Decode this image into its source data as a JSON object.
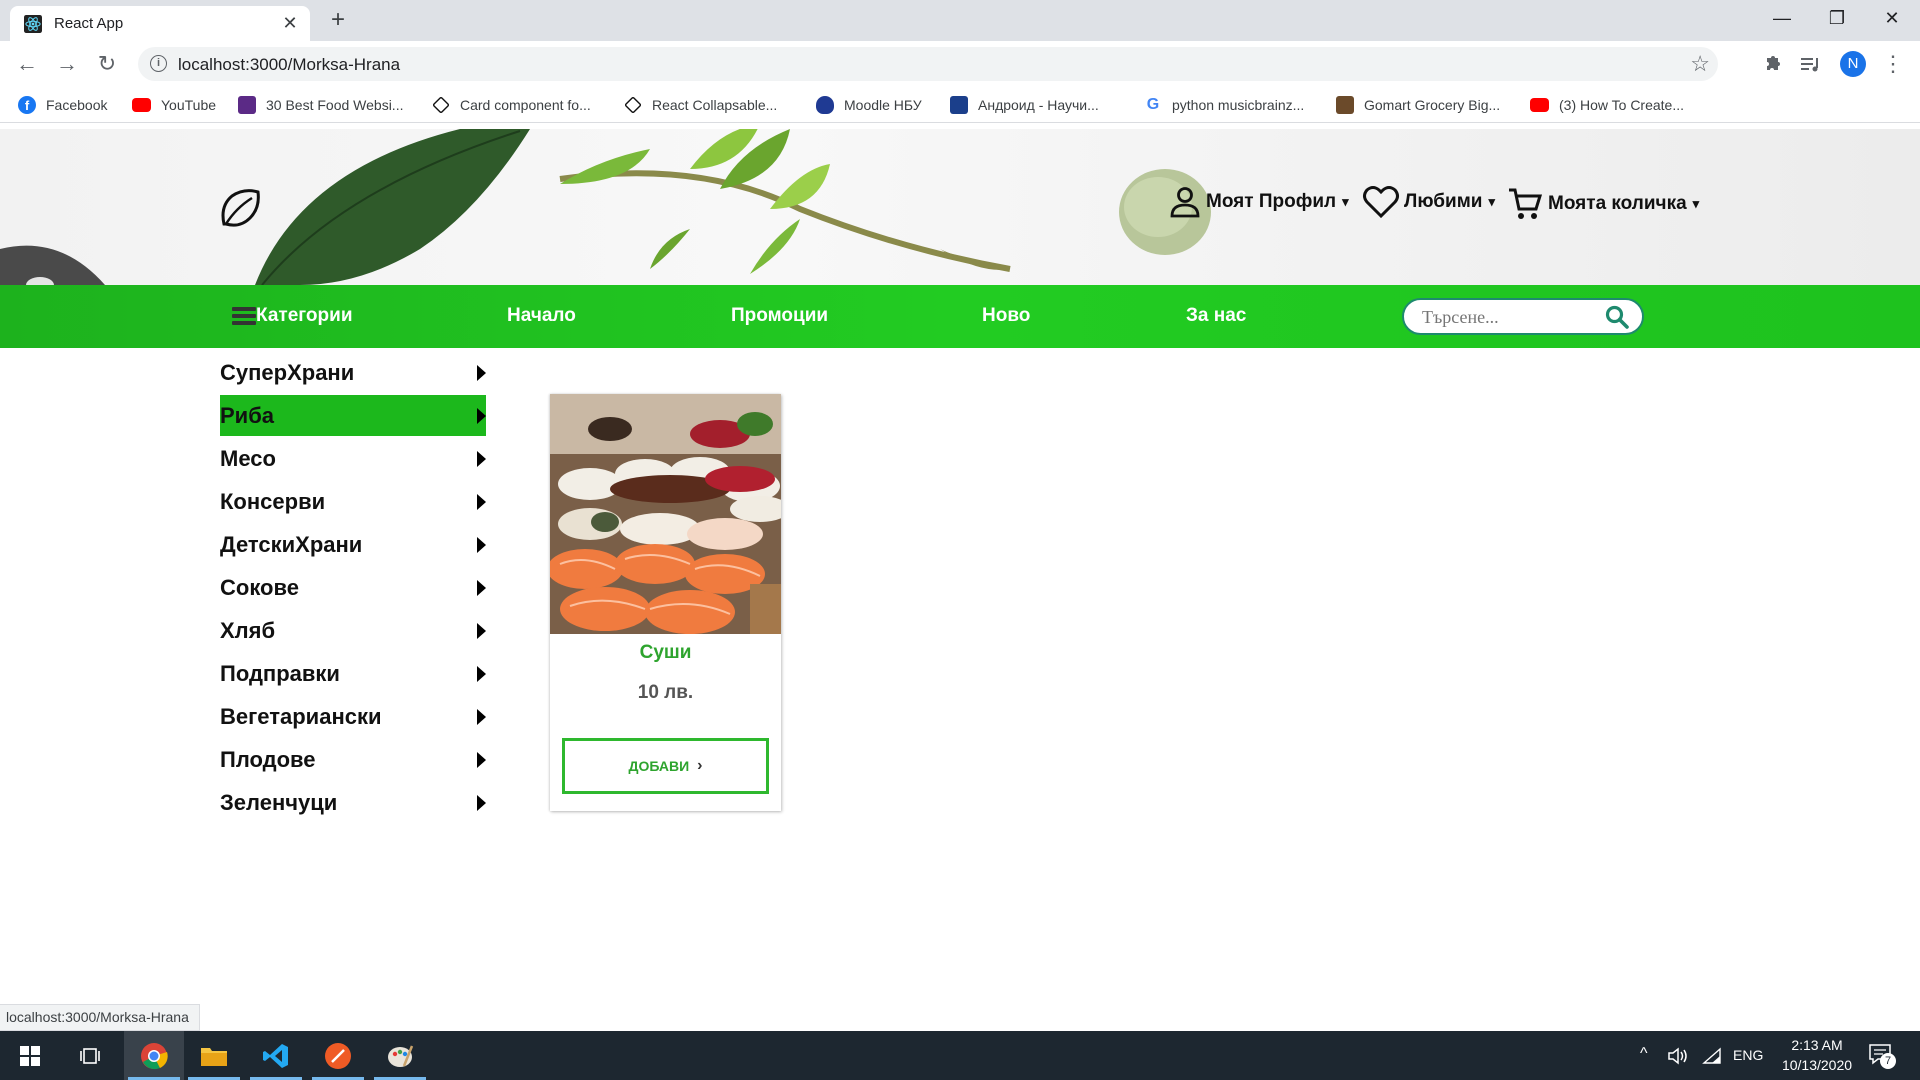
{
  "browser": {
    "tab_title": "React App",
    "tab_close": "✕",
    "new_tab": "+",
    "url": "localhost:3000/Morksa-Hrana",
    "window_controls": {
      "minimize": "—",
      "maximize": "❐",
      "close": "✕"
    },
    "profile_initial": "N",
    "status_url": "localhost:3000/Morksa-Hrana"
  },
  "bookmarks": [
    {
      "label": "Facebook",
      "icon": "facebook-icon",
      "color": "#1877f2"
    },
    {
      "label": "YouTube",
      "icon": "youtube-icon",
      "color": "#ff0000"
    },
    {
      "label": "30 Best Food Websi...",
      "icon": "colorlib-icon",
      "color": "#5b2a86"
    },
    {
      "label": "Card component fo...",
      "icon": "codepen-icon",
      "color": "#111111"
    },
    {
      "label": "React Collapsable...",
      "icon": "codepen-icon",
      "color": "#111111"
    },
    {
      "label": "Moodle НБУ",
      "icon": "moodle-icon",
      "color": "#1f3a93"
    },
    {
      "label": "Андроид - Научи...",
      "icon": "site-icon",
      "color": "#1b3f8b"
    },
    {
      "label": "python musicbrainz...",
      "icon": "google-icon",
      "color": "#4285f4"
    },
    {
      "label": "Gomart Grocery Big...",
      "icon": "gomart-icon",
      "color": "#6b4a2a"
    },
    {
      "label": "(3) How To Create...",
      "icon": "youtube-icon",
      "color": "#ff0000"
    }
  ],
  "header": {
    "profile_label": "Моят Профил",
    "favorites_label": "Любими",
    "cart_label": "Моята количка",
    "caret": "▾"
  },
  "nav": {
    "categories_label": "Категории",
    "home_label": "Начало",
    "promotions_label": "Промоции",
    "new_label": "Ново",
    "about_label": "За нас",
    "search_placeholder": "Търсене..."
  },
  "sidebar": {
    "items": [
      {
        "label": "СуперХрани",
        "active": false
      },
      {
        "label": "Риба",
        "active": true
      },
      {
        "label": "Месо",
        "active": false
      },
      {
        "label": "Консерви",
        "active": false
      },
      {
        "label": "ДетскиХрани",
        "active": false
      },
      {
        "label": "Сокове",
        "active": false
      },
      {
        "label": "Хляб",
        "active": false
      },
      {
        "label": "Подправки",
        "active": false
      },
      {
        "label": "Вегетариански",
        "active": false
      },
      {
        "label": "Плодове",
        "active": false
      },
      {
        "label": "Зеленчуци",
        "active": false
      }
    ]
  },
  "product": {
    "name": "Суши",
    "price": "10 лв.",
    "button_label": "ДОБАВИ",
    "button_chevron": "›"
  },
  "taskbar": {
    "time": "2:13 AM",
    "date": "10/13/2020",
    "language": "ENG",
    "notifications": "7"
  },
  "colors": {
    "nav_green": "#1db91d",
    "accent_green": "#2ea42e",
    "search_border": "#1e8a6e"
  }
}
